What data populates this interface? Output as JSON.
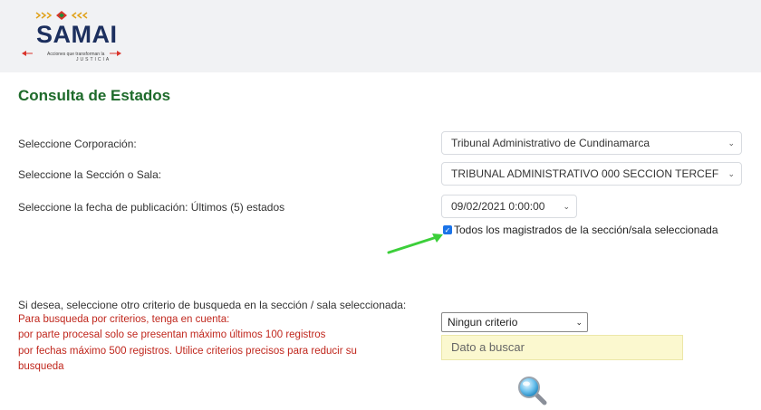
{
  "header": {
    "logo_text": "SAMAI",
    "logo_tagline": "Acciones que transforman la",
    "logo_tagline2": "JUSTICIA"
  },
  "page": {
    "title": "Consulta de Estados"
  },
  "form": {
    "corporacion_label": "Seleccione Corporación:",
    "corporacion_value": "Tribunal Administrativo de Cundinamarca",
    "seccion_label": "Seleccione la Sección o Sala:",
    "seccion_value": "TRIBUNAL ADMINISTRATIVO 000 SECCION TERCEF",
    "fecha_label": "Seleccione la fecha de publicación: Últimos (5) estados",
    "fecha_value": "09/02/2021 0:00:00",
    "checkbox_label": "Todos los magistrados de la sección/sala seleccionada",
    "checkbox_checked": true
  },
  "criteria": {
    "intro": "Si desea, seleccione otro criterio de busqueda en la sección / sala seleccionada:",
    "note1": "Para busqueda por criterios, tenga en cuenta:",
    "note2": "por parte procesal solo se presentan máximo últimos 100 registros",
    "note3": "por fechas máximo 500 registros. Utilice criterios precisos para reducir su",
    "note4": "busqueda",
    "select_value": "Ningun criterio",
    "search_placeholder": "Dato a buscar"
  },
  "colors": {
    "title": "#1d6a2a",
    "note": "#c0271d",
    "search_bg": "#fbf8cf",
    "annotation_arrow": "#3ccf3a"
  },
  "icons": [
    "search-icon",
    "chevron-down-icon",
    "checkbox-icon",
    "annotation-arrow"
  ]
}
